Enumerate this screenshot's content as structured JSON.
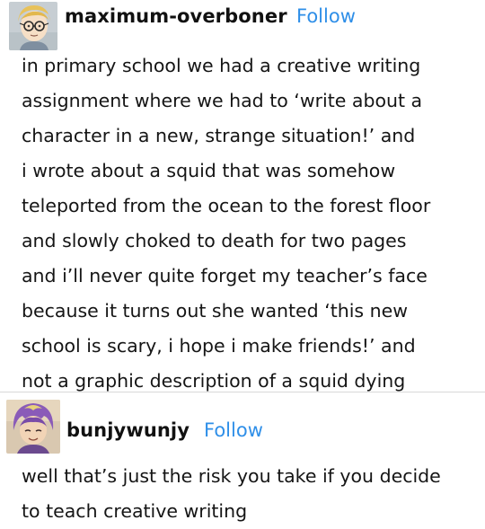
{
  "posts": [
    {
      "username": "maximum-overboner",
      "follow_label": "Follow",
      "lines": [
        "in primary school we had a creative writing",
        "assignment where we had to ‘write about a",
        "character in a new, strange situation!’ and",
        "i wrote about a squid that was somehow",
        "teleported from the ocean to the forest floor",
        "and slowly choked to death for two pages",
        "and i’ll never quite forget my teacher’s face",
        "because it turns out she wanted ‘this new",
        "school is scary, i hope i make friends!’ and",
        "not a graphic description of a squid dying"
      ]
    },
    {
      "username": "bunjywunjy",
      "follow_label": "Follow",
      "lines": [
        "well that’s just the risk you take if you decide",
        "to teach creative writing"
      ]
    }
  ],
  "colors": {
    "follow": "#2f8fe8",
    "text": "#151515",
    "divider": "#d9d9d9"
  },
  "icons": {
    "post_1_avatar": "cartoon-boy-with-glasses-avatar",
    "post_2_avatar": "cartoon-purple-haired-character-avatar"
  }
}
